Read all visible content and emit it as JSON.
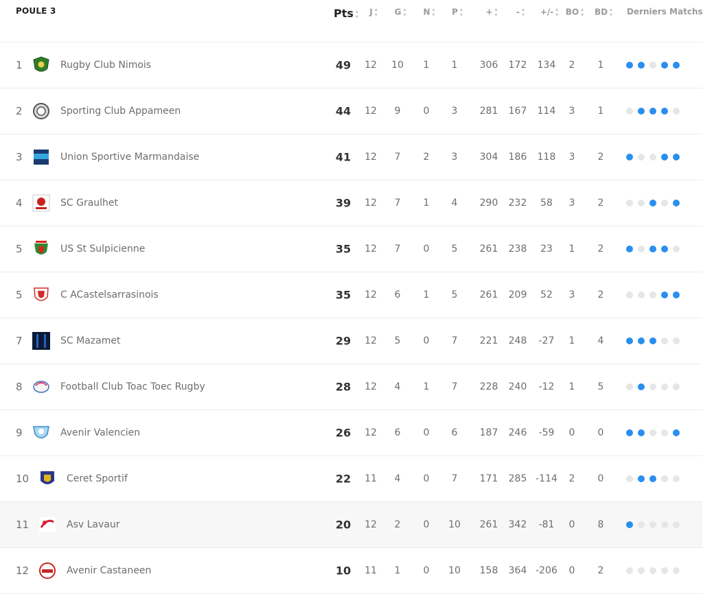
{
  "header": {
    "title": "POULE 3",
    "columns": [
      "Pts",
      "J",
      "G",
      "N",
      "P",
      "+",
      "-",
      "+/-",
      "BO",
      "BD"
    ],
    "last": "Derniers Matchs"
  },
  "colors": {
    "win": "#2a8ef0",
    "other": "#e6e6e6"
  },
  "rows": [
    {
      "rank": "1",
      "team": "Rugby Club Nimois",
      "pts": "49",
      "j": "12",
      "g": "10",
      "n": "1",
      "p": "1",
      "plus": "306",
      "minus": "172",
      "diff": "134",
      "bo": "2",
      "bd": "1",
      "form": [
        1,
        1,
        0,
        1,
        1
      ],
      "logo": "green-shield"
    },
    {
      "rank": "2",
      "team": "Sporting Club Appameen",
      "pts": "44",
      "j": "12",
      "g": "9",
      "n": "0",
      "p": "3",
      "plus": "281",
      "minus": "167",
      "diff": "114",
      "bo": "3",
      "bd": "1",
      "form": [
        0,
        1,
        1,
        1,
        0
      ],
      "logo": "grey-crest"
    },
    {
      "rank": "3",
      "team": "Union Sportive Marmandaise",
      "pts": "41",
      "j": "12",
      "g": "7",
      "n": "2",
      "p": "3",
      "plus": "304",
      "minus": "186",
      "diff": "118",
      "bo": "3",
      "bd": "2",
      "form": [
        1,
        0,
        0,
        1,
        1
      ],
      "logo": "blue-shield"
    },
    {
      "rank": "4",
      "team": "SC Graulhet",
      "pts": "39",
      "j": "12",
      "g": "7",
      "n": "1",
      "p": "4",
      "plus": "290",
      "minus": "232",
      "diff": "58",
      "bo": "3",
      "bd": "2",
      "form": [
        0,
        0,
        1,
        0,
        1
      ],
      "logo": "red-emblem"
    },
    {
      "rank": "5",
      "team": "US St Sulpicienne",
      "pts": "35",
      "j": "12",
      "g": "7",
      "n": "0",
      "p": "5",
      "plus": "261",
      "minus": "238",
      "diff": "23",
      "bo": "1",
      "bd": "2",
      "form": [
        1,
        0,
        1,
        1,
        0
      ],
      "logo": "green-red-shield"
    },
    {
      "rank": "5",
      "team": "C ACastelsarrasinois",
      "pts": "35",
      "j": "12",
      "g": "6",
      "n": "1",
      "p": "5",
      "plus": "261",
      "minus": "209",
      "diff": "52",
      "bo": "3",
      "bd": "2",
      "form": [
        0,
        0,
        0,
        1,
        1
      ],
      "logo": "red-white-shield"
    },
    {
      "rank": "7",
      "team": "SC Mazamet",
      "pts": "29",
      "j": "12",
      "g": "5",
      "n": "0",
      "p": "7",
      "plus": "221",
      "minus": "248",
      "diff": "-27",
      "bo": "1",
      "bd": "4",
      "form": [
        1,
        1,
        1,
        0,
        0
      ],
      "logo": "dark-square"
    },
    {
      "rank": "8",
      "team": "Football Club Toac Toec Rugby",
      "pts": "28",
      "j": "12",
      "g": "4",
      "n": "1",
      "p": "7",
      "plus": "228",
      "minus": "240",
      "diff": "-12",
      "bo": "1",
      "bd": "5",
      "form": [
        0,
        1,
        0,
        0,
        0
      ],
      "logo": "ball-emblem"
    },
    {
      "rank": "9",
      "team": "Avenir Valencien",
      "pts": "26",
      "j": "12",
      "g": "6",
      "n": "0",
      "p": "6",
      "plus": "187",
      "minus": "246",
      "diff": "-59",
      "bo": "0",
      "bd": "0",
      "form": [
        1,
        1,
        0,
        0,
        1
      ],
      "logo": "light-blue-shield"
    },
    {
      "rank": "10",
      "team": "Ceret Sportif",
      "pts": "22",
      "j": "11",
      "g": "4",
      "n": "0",
      "p": "7",
      "plus": "171",
      "minus": "285",
      "diff": "-114",
      "bo": "2",
      "bd": "0",
      "form": [
        0,
        1,
        1,
        0,
        0
      ],
      "logo": "navy-gold-shield"
    },
    {
      "rank": "11",
      "team": "Asv Lavaur",
      "pts": "20",
      "j": "12",
      "g": "2",
      "n": "0",
      "p": "10",
      "plus": "261",
      "minus": "342",
      "diff": "-81",
      "bo": "0",
      "bd": "8",
      "form": [
        1,
        0,
        0,
        0,
        0
      ],
      "logo": "red-swoosh"
    },
    {
      "rank": "12",
      "team": "Avenir Castaneen",
      "pts": "10",
      "j": "11",
      "g": "1",
      "n": "0",
      "p": "10",
      "plus": "158",
      "minus": "364",
      "diff": "-206",
      "bo": "0",
      "bd": "2",
      "form": [
        0,
        0,
        0,
        0,
        0
      ],
      "logo": "red-round-crest"
    }
  ]
}
